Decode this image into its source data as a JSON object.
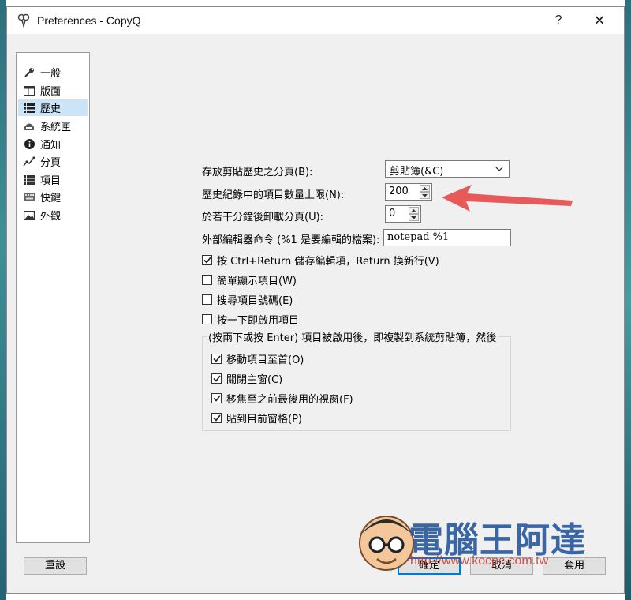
{
  "window": {
    "title": "Preferences - CopyQ",
    "help_label": "?",
    "close_label": "✕"
  },
  "sidebar": {
    "items": [
      {
        "label": "一般",
        "icon": "wrench-icon"
      },
      {
        "label": "版面",
        "icon": "layout-icon"
      },
      {
        "label": "歷史",
        "icon": "list-icon",
        "selected": true
      },
      {
        "label": "系統匣",
        "icon": "tray-icon"
      },
      {
        "label": "通知",
        "icon": "info-icon"
      },
      {
        "label": "分頁",
        "icon": "tabs-icon"
      },
      {
        "label": "項目",
        "icon": "items-icon"
      },
      {
        "label": "快鍵",
        "icon": "keyboard-icon"
      },
      {
        "label": "外觀",
        "icon": "appearance-icon"
      }
    ]
  },
  "history": {
    "store_tab_label": "存放剪貼歷史之分頁(B):",
    "store_tab_value": "剪貼簿(&C)",
    "max_items_label": "歷史紀錄中的項目數量上限(N):",
    "max_items_value": "200",
    "unload_label": "於若干分鐘後卸載分頁(U):",
    "unload_value": "0",
    "editor_label": "外部編輯器命令 (%1 是要編輯的檔案):",
    "editor_value": "notepad %1",
    "cb_ctrl_return": {
      "label": "按 Ctrl+Return 儲存編輯項，Return 換新行(V)",
      "checked": true
    },
    "cb_simple": {
      "label": "簡單顯示項目(W)",
      "checked": false
    },
    "cb_search_num": {
      "label": "搜尋項目號碼(E)",
      "checked": false
    },
    "cb_single_click": {
      "label": "按一下即啟用項目",
      "checked": false
    },
    "group_title": "(按兩下或按 Enter) 項目被啟用後，即複製到系統剪貼簿，然後",
    "group": [
      {
        "label": "移動項目至首(O)",
        "checked": true
      },
      {
        "label": "關閉主窗(C)",
        "checked": true
      },
      {
        "label": "移焦至之前最後用的視窗(F)",
        "checked": true
      },
      {
        "label": "貼到目前窗格(P)",
        "checked": true
      }
    ]
  },
  "buttons": {
    "reset": "重設",
    "ok": "確定",
    "cancel": "取消",
    "apply": "套用"
  },
  "watermark": {
    "text": "電腦王阿達",
    "url": "http://www.kocpc.com.tw"
  },
  "colors": {
    "selection": "#cce4f7",
    "accent": "#0078d7",
    "arrow": "#e8595a"
  }
}
